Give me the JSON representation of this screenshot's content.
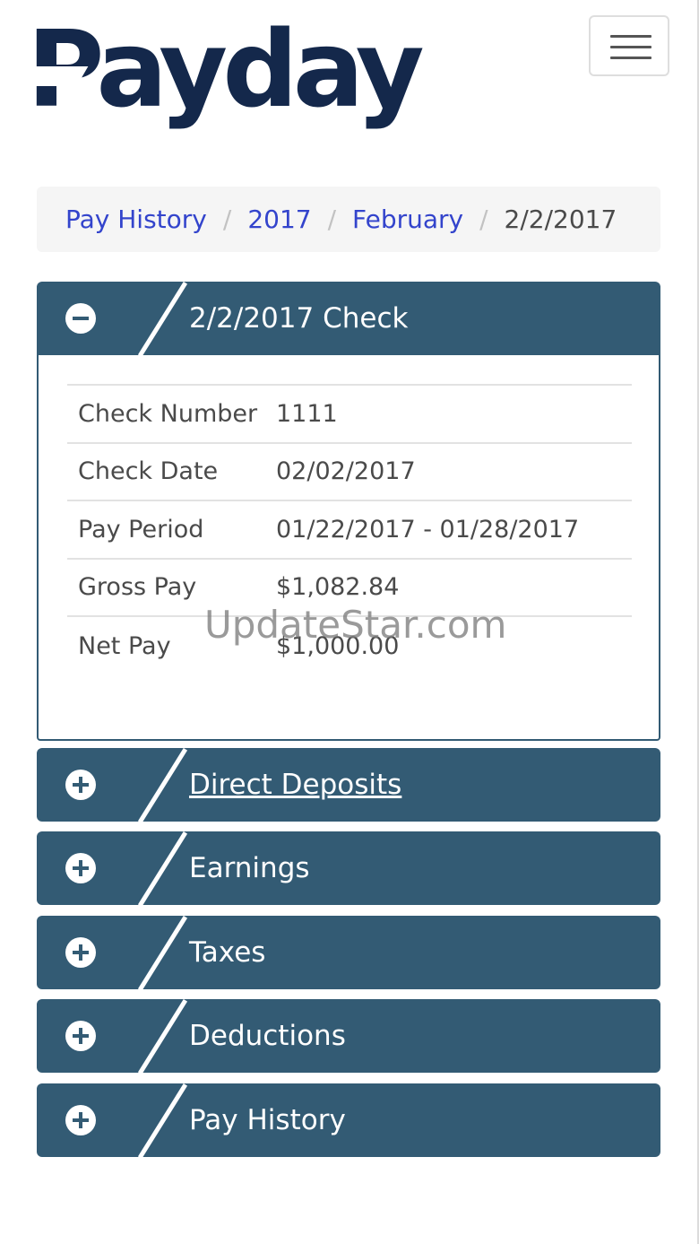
{
  "header": {
    "logo_text": "Payday",
    "menu_icon": "hamburger-menu-icon"
  },
  "breadcrumb": {
    "items": [
      "Pay History",
      "2017",
      "February"
    ],
    "current": "2/2/2017",
    "separator": "/"
  },
  "check_panel": {
    "title": "2/2/2017 Check",
    "toggle_icon": "minus-circle-icon",
    "rows": [
      {
        "label": "Check Number",
        "value": "1111"
      },
      {
        "label": "Check Date",
        "value": "02/02/2017"
      },
      {
        "label": "Pay Period",
        "value": "01/22/2017 - 01/28/2017"
      },
      {
        "label": "Gross Pay",
        "value": "$1,082.84"
      },
      {
        "label": "Net Pay",
        "value": "$1,000.00"
      }
    ]
  },
  "sections": [
    {
      "title": "Direct Deposits",
      "toggle_icon": "plus-circle-icon"
    },
    {
      "title": "Earnings",
      "toggle_icon": "plus-circle-icon"
    },
    {
      "title": "Taxes",
      "toggle_icon": "plus-circle-icon"
    },
    {
      "title": "Deductions",
      "toggle_icon": "plus-circle-icon"
    },
    {
      "title": "Pay History",
      "toggle_icon": "plus-circle-icon"
    }
  ],
  "watermark": "UpdateStar.com",
  "colors": {
    "brand_navy": "#14284b",
    "panel_blue": "#335b74",
    "link_blue": "#3344cc"
  }
}
